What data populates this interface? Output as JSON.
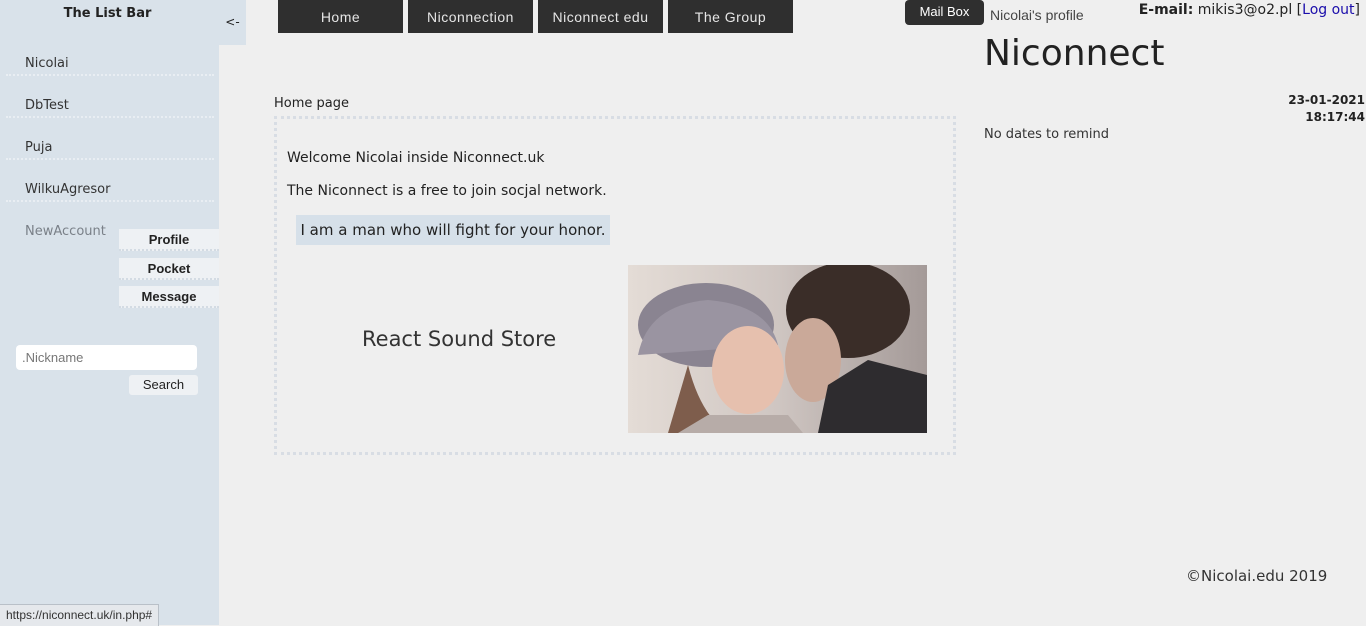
{
  "sidebar": {
    "title": "The List Bar",
    "collapse_label": "<-",
    "users": [
      "Nicolai",
      "DbTest",
      "Puja",
      "WilkuAgresor"
    ],
    "new_account": "NewAccount",
    "actions": {
      "profile": "Profile",
      "pocket": "Pocket",
      "message": "Message"
    },
    "search": {
      "placeholder": ".Nickname",
      "button": "Search"
    }
  },
  "nav": {
    "home": "Home",
    "niconnection": "Niconnection",
    "edu": "Niconnect edu",
    "group": "The Group"
  },
  "header": {
    "mailbox": "Mail Box",
    "profile_link": "Nicolai's profile",
    "email_label": "E-mail:",
    "email": "mikis3@o2.pl",
    "logout": "Log out",
    "site_title": "Niconnect",
    "date": "23-01-2021",
    "time": "18:17:44",
    "reminders": "No dates to remind"
  },
  "main": {
    "breadcrumb": "Home page",
    "welcome": "Welcome Nicolai inside Niconnect.uk",
    "intro": "The Niconnect is a free to join socjal network.",
    "quote": "I am a man who will fight for your honor.",
    "store_link": "React Sound Store"
  },
  "footer": "©Nicolai.edu 2019",
  "status_url": "https://niconnect.uk/in.php#"
}
